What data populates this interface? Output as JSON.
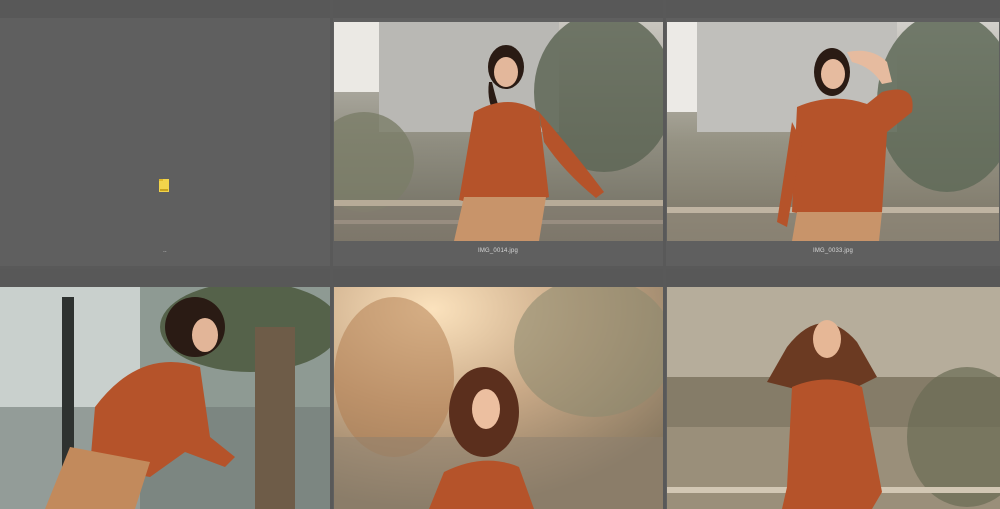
{
  "items": [
    {
      "label": "..",
      "kind": "folder"
    },
    {
      "label": "IMG_0014.jpg",
      "kind": "photo"
    },
    {
      "label": "IMG_0033.jpg",
      "kind": "photo"
    },
    {
      "label": "",
      "kind": "photo"
    },
    {
      "label": "",
      "kind": "photo"
    },
    {
      "label": "",
      "kind": "photo"
    }
  ],
  "icons": {
    "folder": "folder-icon"
  },
  "colors": {
    "background": "#595959",
    "cell": "#5f5f5f",
    "folder": "#f2d44b",
    "sweater": "#b5532a"
  }
}
